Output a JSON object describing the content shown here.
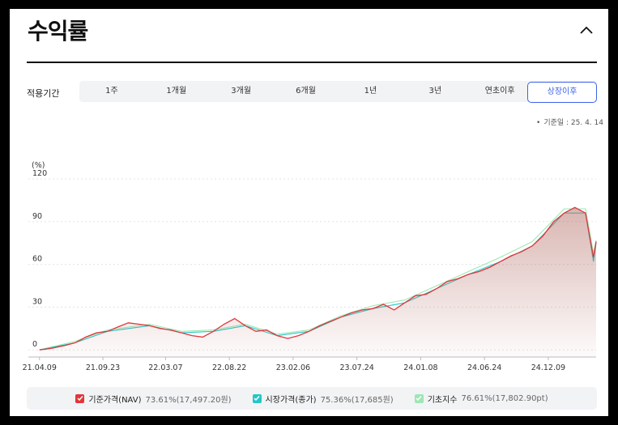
{
  "header": {
    "title": "수익률",
    "collapse_icon": "chevron-up-icon"
  },
  "period": {
    "label": "적용기간",
    "tabs": [
      "1주",
      "1개월",
      "3개월",
      "6개월",
      "1년",
      "3년",
      "연초이후",
      "상장이후"
    ],
    "active_index": 7,
    "accent_color": "#3b63e8"
  },
  "reference_date": "기준일 : 25. 4. 14",
  "legend": [
    {
      "name": "기준가격(NAV)",
      "value": "73.61%(17,497.20원)",
      "color": "#e0363a"
    },
    {
      "name": "시장가격(종가)",
      "value": "75.36%(17,685원)",
      "color": "#22c7c7"
    },
    {
      "name": "기초지수",
      "value": "76.61%(17,802.90pt)",
      "color": "#9ee6b5"
    }
  ],
  "chart_data": {
    "type": "area",
    "ylabel": "(%)",
    "ylim": [
      -5,
      120
    ],
    "yticks": [
      0,
      30,
      60,
      90,
      120
    ],
    "xlim": [
      "2021-04-01",
      "2025-04-14"
    ],
    "xticks": [
      "21.04.09",
      "21.09.23",
      "22.03.07",
      "22.08.22",
      "23.02.06",
      "23.07.24",
      "24.01.08",
      "24.06.24",
      "24.12.09"
    ],
    "grid": true,
    "legend_position": "bottom",
    "series": [
      {
        "name": "기준가격(NAV)",
        "color": "#e0363a",
        "fill": "gradient",
        "x": [
          "2021-04-09",
          "2021-05-10",
          "2021-06-14",
          "2021-07-12",
          "2021-08-09",
          "2021-09-06",
          "2021-10-05",
          "2021-11-01",
          "2021-11-29",
          "2021-12-27",
          "2022-01-24",
          "2022-02-21",
          "2022-03-21",
          "2022-04-18",
          "2022-05-16",
          "2022-06-13",
          "2022-07-11",
          "2022-08-08",
          "2022-09-05",
          "2022-10-03",
          "2022-10-31",
          "2022-11-28",
          "2022-12-26",
          "2023-01-23",
          "2023-02-20",
          "2023-03-20",
          "2023-04-17",
          "2023-05-15",
          "2023-06-12",
          "2023-07-10",
          "2023-08-07",
          "2023-09-04",
          "2023-10-02",
          "2023-10-30",
          "2023-11-27",
          "2023-12-25",
          "2024-01-22",
          "2024-02-19",
          "2024-03-18",
          "2024-04-15",
          "2024-05-13",
          "2024-06-10",
          "2024-07-08",
          "2024-08-05",
          "2024-09-02",
          "2024-09-30",
          "2024-10-28",
          "2024-11-25",
          "2024-12-23",
          "2025-01-20",
          "2025-02-17",
          "2025-03-17",
          "2025-04-07",
          "2025-04-14"
        ],
        "values": [
          0,
          1,
          3,
          5,
          9,
          12,
          13,
          16,
          19,
          18,
          17,
          15,
          14,
          12,
          10,
          9,
          13,
          18,
          22,
          17,
          13,
          14,
          10,
          8,
          10,
          13,
          17,
          20,
          23,
          26,
          28,
          29,
          32,
          28,
          33,
          38,
          39,
          43,
          48,
          50,
          53,
          55,
          58,
          62,
          66,
          69,
          73,
          80,
          90,
          96,
          100,
          96,
          65,
          76
        ]
      },
      {
        "name": "시장가격(종가)",
        "color": "#22c7c7",
        "x": [
          "2021-04-09",
          "2021-07-12",
          "2021-10-05",
          "2022-01-24",
          "2022-04-18",
          "2022-07-11",
          "2022-10-03",
          "2022-12-26",
          "2023-03-20",
          "2023-06-12",
          "2023-09-04",
          "2023-11-27",
          "2024-02-19",
          "2024-05-13",
          "2024-08-05",
          "2024-10-28",
          "2025-01-20",
          "2025-03-17",
          "2025-04-07",
          "2025-04-14"
        ],
        "values": [
          0,
          5,
          13,
          17,
          12,
          13,
          17,
          10,
          13,
          23,
          29,
          33,
          43,
          53,
          62,
          73,
          96,
          96,
          62,
          75
        ]
      },
      {
        "name": "기초지수",
        "color": "#9ee6b5",
        "x": [
          "2021-04-09",
          "2021-07-12",
          "2021-10-05",
          "2022-01-24",
          "2022-04-18",
          "2022-07-11",
          "2022-10-03",
          "2022-12-26",
          "2023-03-20",
          "2023-06-12",
          "2023-09-04",
          "2023-11-27",
          "2024-02-19",
          "2024-05-13",
          "2024-08-05",
          "2024-10-28",
          "2025-01-20",
          "2025-03-17",
          "2025-04-07",
          "2025-04-14"
        ],
        "values": [
          0,
          6,
          14,
          18,
          13,
          14,
          18,
          11,
          14,
          24,
          31,
          35,
          45,
          55,
          65,
          76,
          99,
          99,
          68,
          77
        ]
      }
    ]
  }
}
